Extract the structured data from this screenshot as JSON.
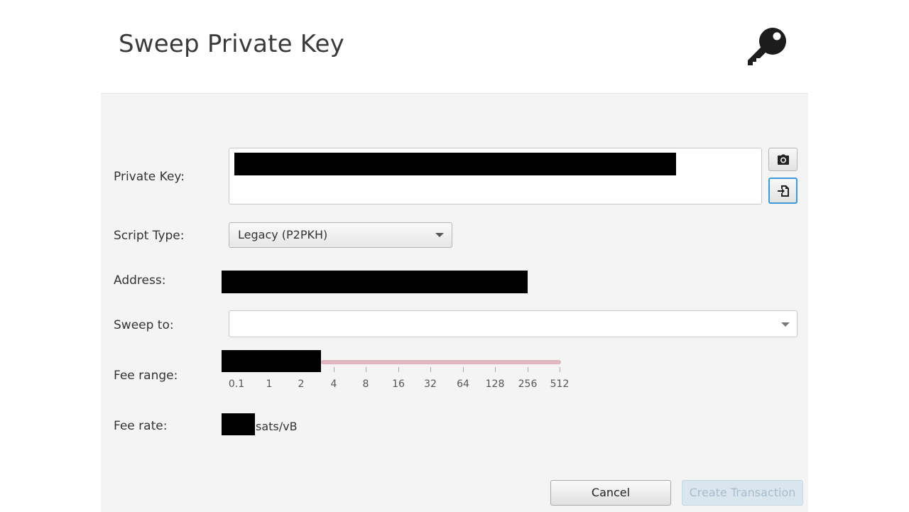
{
  "dialog": {
    "title": "Sweep Private Key",
    "header_icon": "key-icon"
  },
  "form": {
    "private_key": {
      "label": "Private Key:",
      "value_redacted": true
    },
    "script_type": {
      "label": "Script Type:",
      "selected": "Legacy (P2PKH)"
    },
    "address": {
      "label": "Address:",
      "value_redacted": true
    },
    "sweep_to": {
      "label": "Sweep to:",
      "value": ""
    },
    "fee_range": {
      "label": "Fee range:",
      "ticks": [
        "0.1",
        "1",
        "2",
        "4",
        "8",
        "16",
        "32",
        "64",
        "128",
        "256",
        "512"
      ]
    },
    "fee_rate": {
      "label": "Fee rate:",
      "unit": "sats/vB",
      "value_redacted": true
    }
  },
  "side_buttons": {
    "scan_icon": "camera-icon",
    "import_icon": "file-import-icon"
  },
  "buttons": {
    "cancel": "Cancel",
    "create": "Create Transaction"
  },
  "colors": {
    "slider_track": "#dfb5bf",
    "focus_border": "#3a9ad9",
    "panel_bg": "#f4f4f4"
  }
}
